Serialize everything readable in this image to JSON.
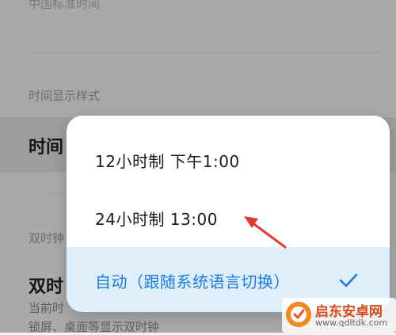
{
  "background": {
    "timezone_value": "中国标准时间",
    "section_time_display": "时间显示样式",
    "time_row_title": "时间",
    "section_dual_clock": "双时钟",
    "dual_clock_title": "双时",
    "dual_clock_sub1": "当前时",
    "dual_clock_sub2": "锁屏、桌面等显示双时钟"
  },
  "popup": {
    "options": [
      {
        "label": "12小时制 下午1:00",
        "selected": false
      },
      {
        "label": "24小时制 13:00",
        "selected": false
      },
      {
        "label": "自动（跟随系统语言切换）",
        "selected": true
      }
    ]
  },
  "colors": {
    "accent": "#1a7be5",
    "annotation_arrow": "#e53935",
    "selected_bg": "#dfeefb"
  },
  "watermark": {
    "name": "启东安卓网",
    "url": "www.qdltdk.com"
  }
}
